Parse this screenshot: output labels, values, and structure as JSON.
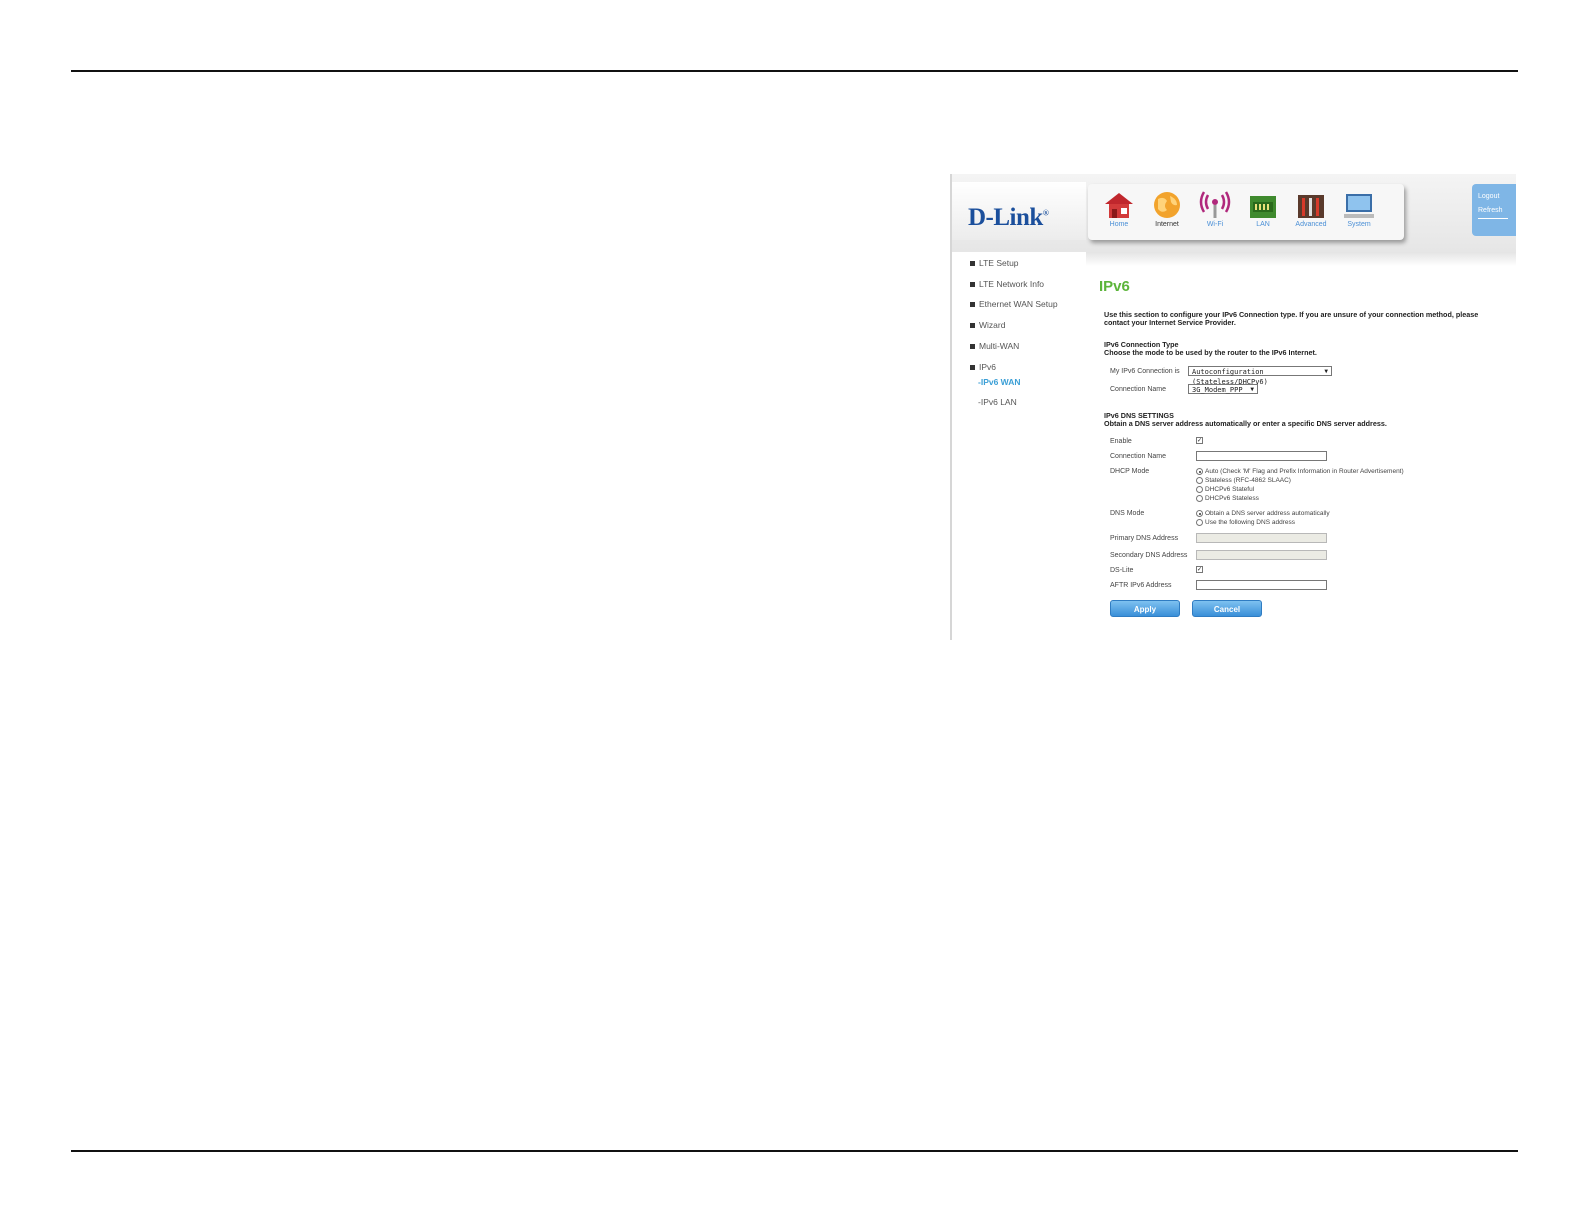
{
  "brand": {
    "logo_text": "D-Link"
  },
  "nav": {
    "items": [
      {
        "label": "Home",
        "icon": "home-icon",
        "active": false
      },
      {
        "label": "Internet",
        "icon": "globe-icon",
        "active": true
      },
      {
        "label": "Wi-Fi",
        "icon": "wifi-icon",
        "active": false
      },
      {
        "label": "LAN",
        "icon": "lan-icon",
        "active": false
      },
      {
        "label": "Advanced",
        "icon": "toolbox-icon",
        "active": false
      },
      {
        "label": "System",
        "icon": "monitor-icon",
        "active": false
      }
    ],
    "logout": "Logout",
    "refresh": "Refresh"
  },
  "sidebar": {
    "items": [
      "LTE Setup",
      "LTE Network Info",
      "Ethernet WAN Setup",
      "Wizard",
      "Multi-WAN",
      "IPv6"
    ],
    "subitems": [
      "-IPv6 WAN",
      "-IPv6 LAN"
    ]
  },
  "main": {
    "title": "IPv6",
    "intro_line1": "Use this section to configure your IPv6 Connection type. If you are unsure of your connection method, please",
    "intro_line2": "contact your Internet Service Provider.",
    "conn_type_heading": "IPv6 Connection Type",
    "conn_type_desc": "Choose the mode to be used by the router to the IPv6 Internet.",
    "my_conn_label": "My IPv6 Connection is",
    "my_conn_value": "Autoconfiguration (Stateless/DHCPv6)",
    "conn_name_label": "Connection Name",
    "conn_name_value": "3G_Modem_PPP",
    "dns_heading": "IPv6 DNS SETTINGS",
    "dns_desc": "Obtain a DNS server address automatically or enter a specific DNS server address.",
    "enable_label": "Enable",
    "dns_conn_name_label": "Connection Name",
    "dhcp_mode_label": "DHCP Mode",
    "dhcp_options": [
      "Auto (Check 'M' Flag and Prefix Information in Router Advertisement)",
      "Stateless (RFC-4862 SLAAC)",
      "DHCPv6 Stateful",
      "DHCPv6 Stateless"
    ],
    "dns_mode_label": "DNS Mode",
    "dns_options": [
      "Obtain a DNS server address automatically",
      "Use the following DNS address"
    ],
    "primary_dns_label": "Primary DNS Address",
    "secondary_dns_label": "Secondary DNS Address",
    "dslite_label": "DS-Lite",
    "aftr_label": "AFTR IPv6 Address",
    "apply_label": "Apply",
    "cancel_label": "Cancel"
  },
  "colors": {
    "title_green": "#5cb53a",
    "link_blue": "#3b9fd6",
    "brand_blue": "#1b4f9c",
    "button_blue": "#3a8fd8"
  }
}
